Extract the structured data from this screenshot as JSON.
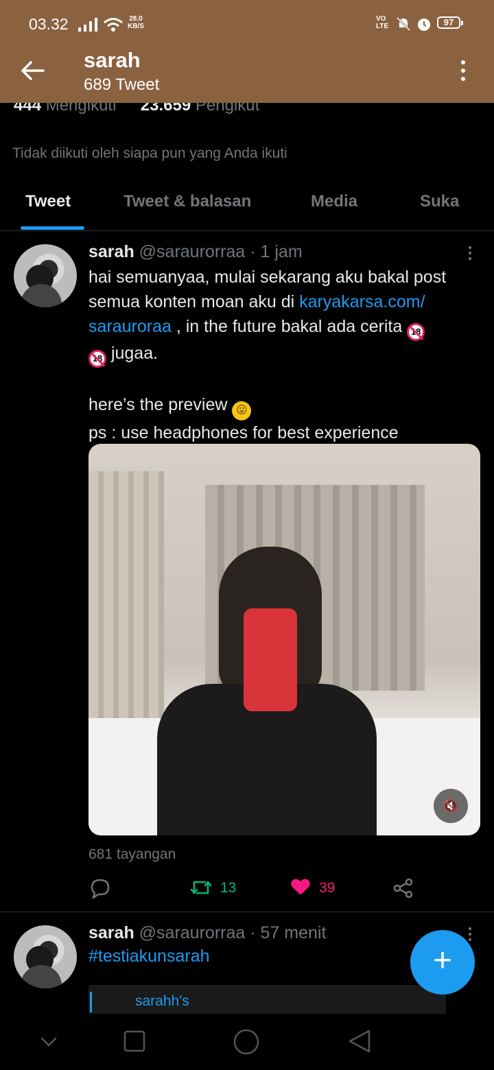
{
  "status_bar": {
    "time": "03.32",
    "net_speed_value": "28.0",
    "net_speed_unit": "KB/S",
    "volte": "VO",
    "lte": "LTE",
    "battery": "97"
  },
  "header": {
    "name": "sarah",
    "tweet_count": "689 Tweet"
  },
  "profile": {
    "following_count": "444",
    "following_label": "Mengikuti",
    "followers_count": "23.659",
    "followers_label": "Pengikut",
    "not_followed_text": "Tidak diikuti oleh siapa pun yang Anda ikuti"
  },
  "tabs": [
    {
      "label": "Tweet",
      "active": true
    },
    {
      "label": "Tweet & balasan",
      "active": false
    },
    {
      "label": "Media",
      "active": false
    },
    {
      "label": "Suka",
      "active": false
    }
  ],
  "tweet1": {
    "name": "sarah",
    "handle": "@saraurorraa",
    "separator": "·",
    "time": "1 jam",
    "line1": "hai semuanyaa, mulai sekarang aku bakal post",
    "line2_pre": "semua konten moan aku di ",
    "link_part1": "karyakarsa.com/",
    "link_part2": "sarauroraa",
    "line3_post": " , in the future bakal ada cerita ",
    "emoji18_label": "18",
    "line4_post": " jugaa.",
    "line5": "here’s the preview",
    "line6": "ps : use headphones for best experience",
    "views": "681 tayangan",
    "retweets": "13",
    "likes": "39"
  },
  "tweet2": {
    "name": "sarah",
    "handle": "@saraurorraa",
    "separator": "·",
    "time": "57 menit",
    "hashtag": "#testiakunsarah",
    "quote_text": "sarahh's"
  },
  "fab": {
    "label": "+"
  },
  "colors": {
    "header_bg": "#8b6240",
    "accent": "#1d9bf0",
    "retweet": "#00ba7c",
    "like": "#f91880"
  }
}
